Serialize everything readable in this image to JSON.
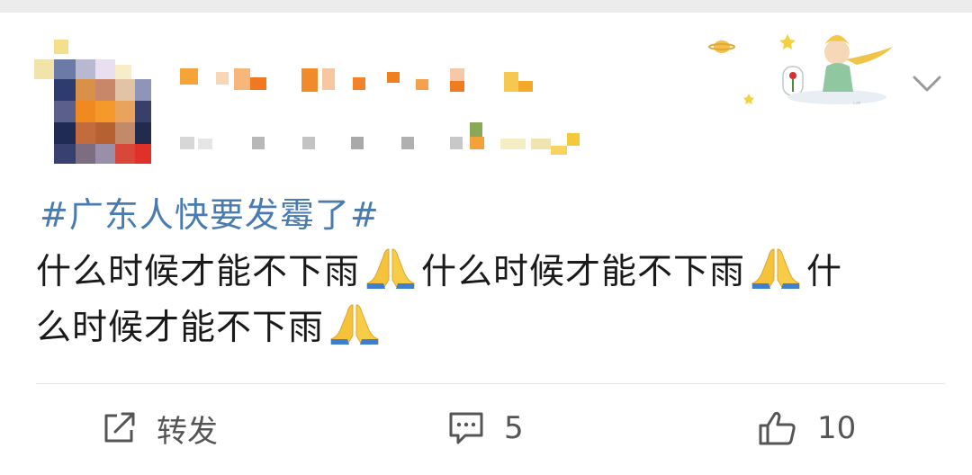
{
  "post": {
    "topic": "#广东人快要发霉了#",
    "text_line1": "什么时候才能不下雨",
    "text_line2": "什么时候才能不下雨",
    "text_line3a": "什",
    "text_line3b": "么时候才能不下雨",
    "emoji": "folded-hands"
  },
  "actions": {
    "repost_label": "转发",
    "comment_count": "5",
    "like_count": "10"
  }
}
